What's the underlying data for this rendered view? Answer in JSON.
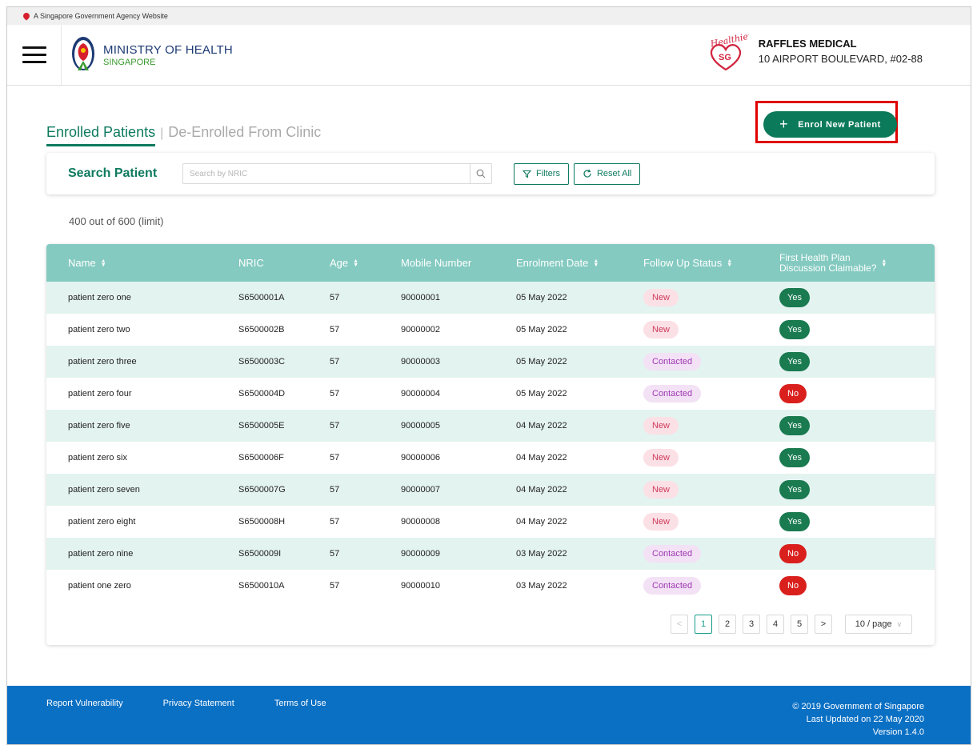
{
  "masthead": {
    "text": "A Singapore Government Agency Website"
  },
  "header": {
    "ministry": "MINISTRY OF HEALTH",
    "country": "SINGAPORE",
    "clinic_name": "RAFFLES MEDICAL",
    "clinic_address": "10 AIRPORT BOULEVARD, #02-88",
    "healthier_logo_text": "Healthier",
    "healthier_logo_badge": "SG"
  },
  "tabs": {
    "active": "Enrolled Patients",
    "inactive": "De-Enrolled From Clinic"
  },
  "enrol_button": {
    "label": "Enrol New Patient"
  },
  "search": {
    "title": "Search Patient",
    "placeholder": "Search by NRIC",
    "filters_label": "Filters",
    "reset_label": "Reset All"
  },
  "count_text": "400 out of 600 (limit)",
  "table": {
    "headers": {
      "name": "Name",
      "nric": "NRIC",
      "age": "Age",
      "mobile": "Mobile Number",
      "date": "Enrolment Date",
      "status": "Follow Up Status",
      "claim_line1": "First Health Plan",
      "claim_line2": "Discussion Claimable?"
    },
    "rows": [
      {
        "name": "patient zero one",
        "nric": "S6500001A",
        "age": "57",
        "mobile": "90000001",
        "date": "05 May 2022",
        "status": "New",
        "claimable": "Yes"
      },
      {
        "name": "patient zero two",
        "nric": "S6500002B",
        "age": "57",
        "mobile": "90000002",
        "date": "05 May 2022",
        "status": "New",
        "claimable": "Yes"
      },
      {
        "name": "patient zero three",
        "nric": "S6500003C",
        "age": "57",
        "mobile": "90000003",
        "date": "05 May 2022",
        "status": "Contacted",
        "claimable": "Yes"
      },
      {
        "name": "patient zero four",
        "nric": "S6500004D",
        "age": "57",
        "mobile": "90000004",
        "date": "05 May 2022",
        "status": "Contacted",
        "claimable": "No"
      },
      {
        "name": "patient zero five",
        "nric": "S6500005E",
        "age": "57",
        "mobile": "90000005",
        "date": "04 May 2022",
        "status": "New",
        "claimable": "Yes"
      },
      {
        "name": "patient zero six",
        "nric": "S6500006F",
        "age": "57",
        "mobile": "90000006",
        "date": "04 May 2022",
        "status": "New",
        "claimable": "Yes"
      },
      {
        "name": "patient zero seven",
        "nric": "S6500007G",
        "age": "57",
        "mobile": "90000007",
        "date": "04 May 2022",
        "status": "New",
        "claimable": "Yes"
      },
      {
        "name": "patient zero eight",
        "nric": "S6500008H",
        "age": "57",
        "mobile": "90000008",
        "date": "04 May 2022",
        "status": "New",
        "claimable": "Yes"
      },
      {
        "name": "patient zero nine",
        "nric": "S6500009I",
        "age": "57",
        "mobile": "90000009",
        "date": "03 May 2022",
        "status": "Contacted",
        "claimable": "No"
      },
      {
        "name": "patient one zero",
        "nric": "S6500010A",
        "age": "57",
        "mobile": "90000010",
        "date": "03 May 2022",
        "status": "Contacted",
        "claimable": "No"
      }
    ]
  },
  "pagination": {
    "prev": "<",
    "next": ">",
    "pages": [
      "1",
      "2",
      "3",
      "4",
      "5"
    ],
    "current": "1",
    "page_size": "10 / page"
  },
  "footer": {
    "links": [
      "Report Vulnerability",
      "Privacy Statement",
      "Terms of Use"
    ],
    "copyright": "© 2019 Government of Singapore",
    "last_updated": "Last Updated on 22 May 2020",
    "version": "Version 1.4.0"
  },
  "colors": {
    "primary": "#0e7a5f",
    "table_header": "#84cac0",
    "row_stripe": "#e3f3f0",
    "footer": "#0a70c4",
    "highlight_box": "#e00000",
    "yes": "#1a7a50",
    "no": "#d9201d"
  },
  "icons": {
    "menu": "hamburger-icon",
    "search": "search-icon",
    "filter": "filter-icon",
    "reset": "refresh-icon",
    "sort": "sort-icon",
    "add": "plus-icon"
  }
}
